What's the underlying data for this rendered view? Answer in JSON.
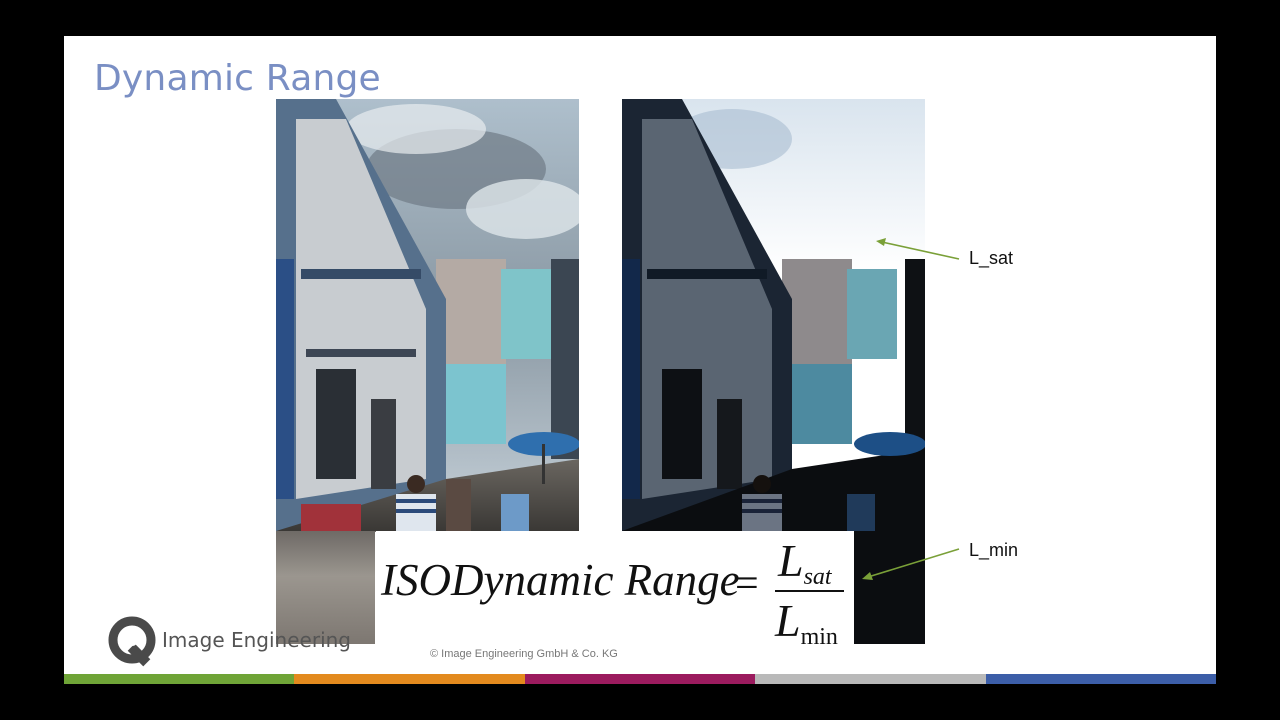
{
  "slide": {
    "title": "Dynamic Range",
    "annotations": {
      "l_sat": "L_sat",
      "l_min": "L_min"
    },
    "formula": {
      "lhs": "ISODynamic Range",
      "equals": "=",
      "numerator_base": "L",
      "numerator_sub": "sat",
      "denominator_base": "L",
      "denominator_sub": "min"
    },
    "footer": {
      "logo_text": "Image Engineering",
      "copyright": "© Image Engineering GmbH & Co. KG"
    },
    "colors": {
      "title": "#7a8fc4",
      "arrow": "#7aa038",
      "bar_segments": [
        "#6fa437",
        "#e38a1e",
        "#9b1b5e",
        "#b9b9b9",
        "#3c5ea8"
      ]
    }
  }
}
